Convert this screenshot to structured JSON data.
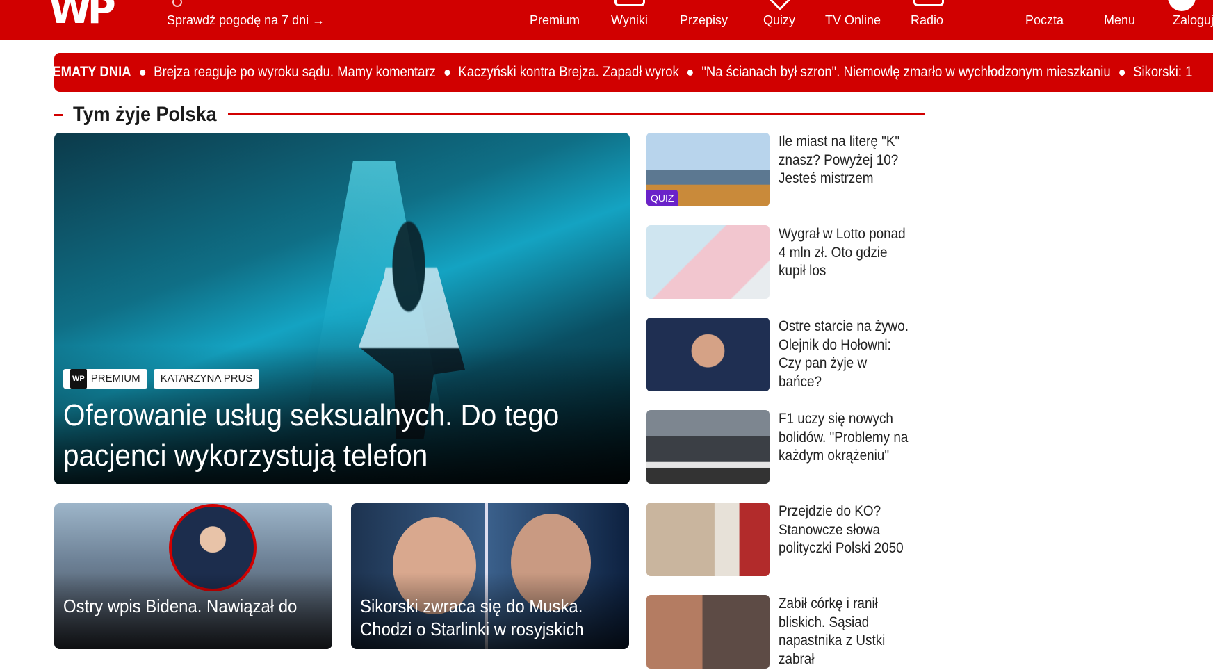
{
  "header": {
    "logo": "WP",
    "weather_link": "Sprawdź pogodę na 7 dni →",
    "nav": [
      "Premium",
      "Wyniki",
      "Przepisy",
      "Quizy",
      "TV Online",
      "Radio",
      "Poczta",
      "Menu",
      "Zaloguj"
    ]
  },
  "ticker": {
    "label": "TEMATY DNIA",
    "items": [
      "Brejza reaguje po wyroku sądu. Mamy komentarz",
      "Kaczyński kontra Brejza. Zapadł wyrok",
      "\"Na ścianach był szron\". Niemowlę zmarło w wychłodzonym mieszkaniu",
      "Sikorski: 1"
    ]
  },
  "section": {
    "title": "Tym żyje Polska"
  },
  "hero": {
    "badge_premium": "PREMIUM",
    "badge_author": "KATARZYNA PRUS",
    "title": "Oferowanie usług seksualnych. Do tego pacjenci wykorzystują telefon"
  },
  "cards": [
    {
      "title": "Ostry wpis Bidena. Nawiązał do"
    },
    {
      "title": "Sikorski zwraca się do Muska. Chodzi o Starlinki w rosyjskich"
    }
  ],
  "side": [
    {
      "title": "Ile miast na literę \"K\" znasz? Powyżej 10? Jesteś mistrzem",
      "badge": "QUIZ"
    },
    {
      "title": "Wygrał w Lotto ponad 4 mln zł. Oto gdzie kupił los"
    },
    {
      "title": "Ostre starcie na żywo. Olejnik do Hołowni: Czy pan żyje w bańce?"
    },
    {
      "title": "F1 uczy się nowych bolidów. \"Problemy na każdym okrążeniu\""
    },
    {
      "title": "Przejdzie do KO? Stanowcze słowa polityczki Polski 2050"
    },
    {
      "title": "Zabił córkę i ranił bliskich. Sąsiad napastnika z Ustki zabrał"
    }
  ],
  "colors": {
    "brand": "#d10000",
    "quiz": "#6a22c9"
  }
}
